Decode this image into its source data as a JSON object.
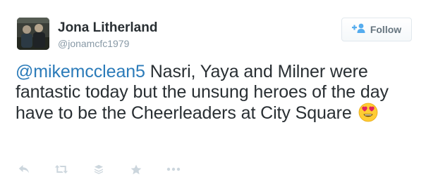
{
  "tweet": {
    "author": {
      "name": "Jona Litherland",
      "handle": "@jonamcfc1979"
    },
    "follow_button": {
      "label": "Follow",
      "icon": "follow-person-plus-icon"
    },
    "mention": "@mikemcclean5",
    "text": " Nasri, Yaya and Milner were fantastic today but the unsung heroes of the day have to be the Cheerleaders at City Square ",
    "emoji": "heart-eyes-emoji"
  },
  "actions": [
    {
      "icon": "reply-icon"
    },
    {
      "icon": "retweet-icon"
    },
    {
      "icon": "layers-icon"
    },
    {
      "icon": "favorite-star-icon"
    },
    {
      "icon": "more-icon"
    }
  ],
  "colors": {
    "link": "#2b7bb9",
    "text": "#292f33",
    "secondary": "#8899a6",
    "action_icon": "#ccd6dd",
    "follow_blue": "#55acee"
  }
}
